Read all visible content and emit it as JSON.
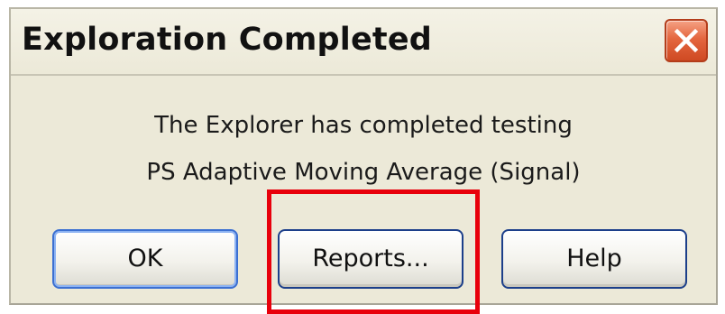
{
  "window": {
    "title": "Exploration Completed",
    "close_icon": "close-icon"
  },
  "message": {
    "line1": "The Explorer has completed testing",
    "line2": "PS Adaptive Moving Average (Signal)"
  },
  "buttons": {
    "ok": "OK",
    "reports": "Reports...",
    "help": "Help"
  },
  "annotation": {
    "highlight_color": "#e8000b",
    "highlighted_target": "Reports..."
  },
  "colors": {
    "dialog_bg": "#ece9d8",
    "close_button": "#e4663f",
    "button_border": "#1c3f8a",
    "default_button_focus": "#3b6fd1"
  }
}
